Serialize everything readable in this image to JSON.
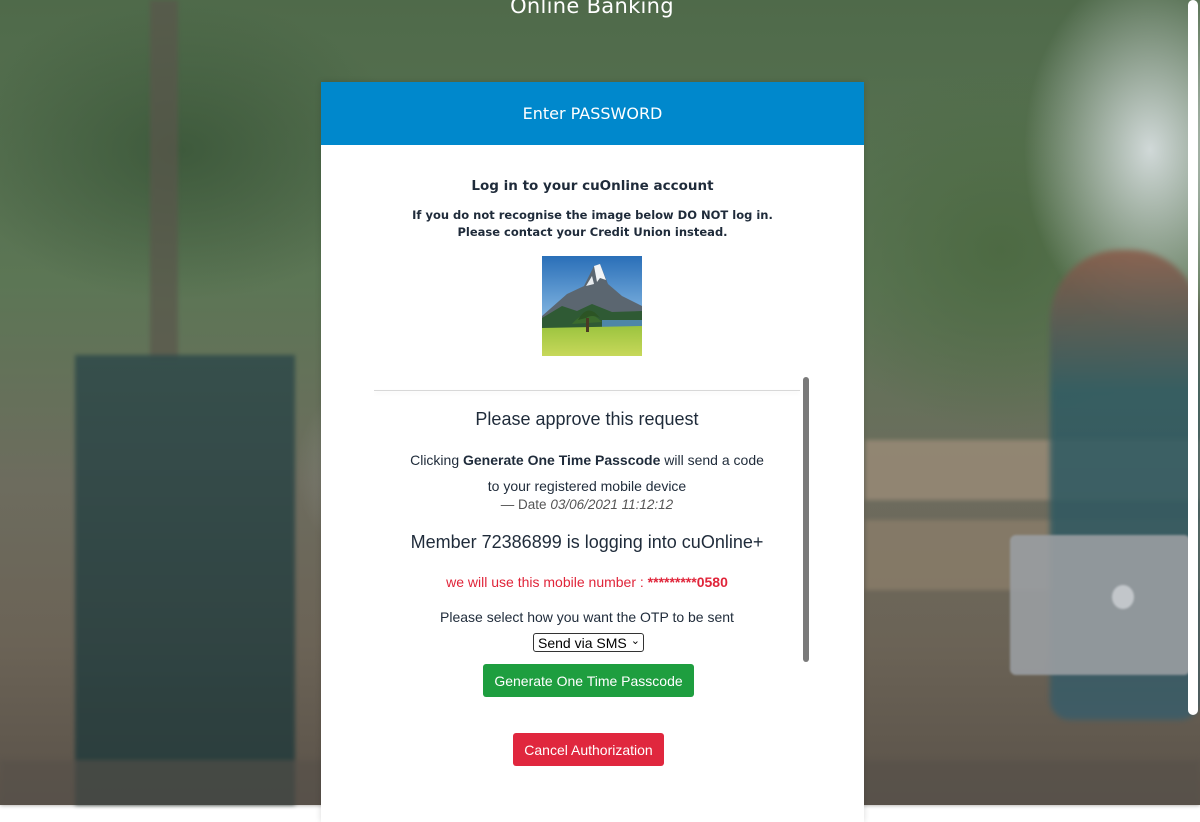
{
  "site": {
    "title": "Online Banking"
  },
  "card": {
    "header": "Enter PASSWORD",
    "login_heading": "Log in to your cuOnline account",
    "warning_prefix": "If you do not recognise the image below ",
    "warning_strong": "DO NOT",
    "warning_suffix": " log in. Please contact your Credit Union instead."
  },
  "approval": {
    "title": "Please approve this request",
    "info_prefix": "Clicking ",
    "info_action": "Generate One Time Passcode",
    "info_suffix": " will send a code",
    "info_line2": "to your registered mobile device",
    "date_prefix": "— Date ",
    "date_value": "03/06/2021 11:12:12",
    "member_line": "Member 72386899 is logging into cuOnline+",
    "mobile_prefix": "we will use this mobile number : ",
    "mobile_value": "*********0580",
    "otp_label": "Please select how you want the OTP to be sent",
    "otp_selected": "Send via SMS"
  },
  "buttons": {
    "generate": "Generate One Time Passcode",
    "cancel": "Cancel Authorization"
  },
  "colors": {
    "header_blue": "#0088cc",
    "generate_green": "#1e9e3f",
    "cancel_red": "#e0273e",
    "mobile_red": "#e0253a"
  }
}
